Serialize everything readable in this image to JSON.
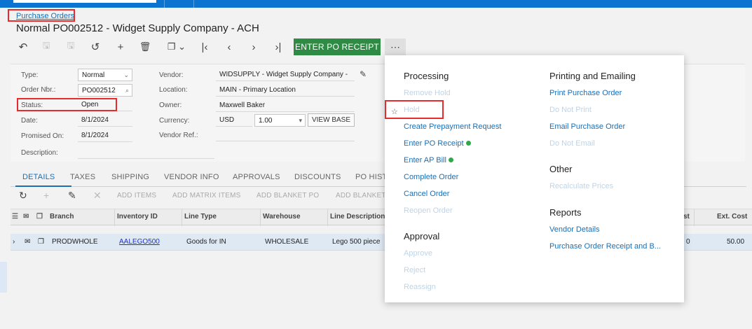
{
  "breadcrumb": "Purchase Orders",
  "page_title": "Normal PO002512 - Widget Supply Company - ACH",
  "toolbar": {
    "enter_receipt": "ENTER PO RECEIPT",
    "more": "⋯"
  },
  "form": {
    "type_label": "Type:",
    "type_value": "Normal",
    "order_nbr_label": "Order Nbr.:",
    "order_nbr_value": "PO002512",
    "status_label": "Status:",
    "status_value": "Open",
    "date_label": "Date:",
    "date_value": "8/1/2024",
    "promised_label": "Promised On:",
    "promised_value": "8/1/2024",
    "description_label": "Description:",
    "vendor_label": "Vendor:",
    "vendor_value": "WIDSUPPLY - Widget Supply Company -",
    "location_label": "Location:",
    "location_value": "MAIN - Primary Location",
    "owner_label": "Owner:",
    "owner_value": "Maxwell Baker",
    "currency_label": "Currency:",
    "currency_value": "USD",
    "rate_value": "1.00",
    "view_base": "VIEW BASE",
    "vendor_ref_label": "Vendor Ref.:"
  },
  "tabs": [
    "DETAILS",
    "TAXES",
    "SHIPPING",
    "VENDOR INFO",
    "APPROVALS",
    "DISCOUNTS",
    "PO HIST"
  ],
  "grid_toolbar": [
    "ADD ITEMS",
    "ADD MATRIX ITEMS",
    "ADD BLANKET PO",
    "ADD BLANKET"
  ],
  "grid": {
    "columns": [
      "Branch",
      "Inventory ID",
      "Line Type",
      "Warehouse",
      "Line Description",
      "st",
      "Ext. Cost"
    ],
    "row": {
      "branch": "PRODWHOLE",
      "inventory_id": "AALEGO500",
      "line_type": "Goods for IN",
      "warehouse": "WHOLESALE",
      "description": "Lego 500 piece",
      "cost_partial": "0",
      "ext_cost": "50.00"
    }
  },
  "menu": {
    "processing_header": "Processing",
    "processing": [
      "Remove Hold",
      "Hold",
      "Create Prepayment Request",
      "Enter PO Receipt",
      "Enter AP Bill",
      "Complete Order",
      "Cancel Order",
      "Reopen Order"
    ],
    "approval_header": "Approval",
    "approval": [
      "Approve",
      "Reject",
      "Reassign"
    ],
    "printing_header": "Printing and Emailing",
    "printing": [
      "Print Purchase Order",
      "Do Not Print",
      "Email Purchase Order",
      "Do Not Email"
    ],
    "other_header": "Other",
    "other": [
      "Recalculate Prices"
    ],
    "reports_header": "Reports",
    "reports": [
      "Vendor Details",
      "Purchase Order Receipt and B..."
    ]
  },
  "colors": {
    "accent": "#1a6fb5",
    "primary_button": "#2e8b44",
    "highlight": "#e52b2b",
    "status_dot": "#2eaa4a"
  }
}
